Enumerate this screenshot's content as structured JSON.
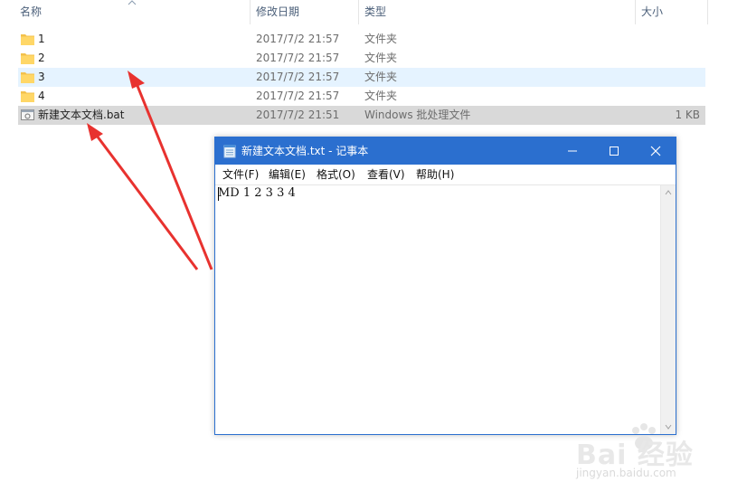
{
  "explorer": {
    "columns": {
      "name": "名称",
      "date": "修改日期",
      "type": "类型",
      "size": "大小"
    },
    "rows": [
      {
        "name": "1",
        "date": "2017/7/2 21:57",
        "type": "文件夹",
        "size": "",
        "icon": "folder-icon"
      },
      {
        "name": "2",
        "date": "2017/7/2 21:57",
        "type": "文件夹",
        "size": "",
        "icon": "folder-icon"
      },
      {
        "name": "3",
        "date": "2017/7/2 21:57",
        "type": "文件夹",
        "size": "",
        "icon": "folder-icon"
      },
      {
        "name": "4",
        "date": "2017/7/2 21:57",
        "type": "文件夹",
        "size": "",
        "icon": "folder-icon"
      },
      {
        "name": "新建文本文档.bat",
        "date": "2017/7/2 21:51",
        "type": "Windows 批处理文件",
        "size": "1 KB",
        "icon": "batch-file-icon"
      }
    ]
  },
  "notepad": {
    "title": "新建文本文档.txt - 记事本",
    "menu": [
      "文件(F)",
      "编辑(E)",
      "格式(O)",
      "查看(V)",
      "帮助(H)"
    ],
    "content": "MD 1 2 3 3 4"
  },
  "watermark": {
    "brand": "Bai  经验",
    "url": "jingyan.baidu.com"
  },
  "colors": {
    "title_bar": "#2b6fcf",
    "hover_row": "#e5f3ff",
    "selected_row": "#d9d9d9",
    "arrow": "#e8322f"
  }
}
